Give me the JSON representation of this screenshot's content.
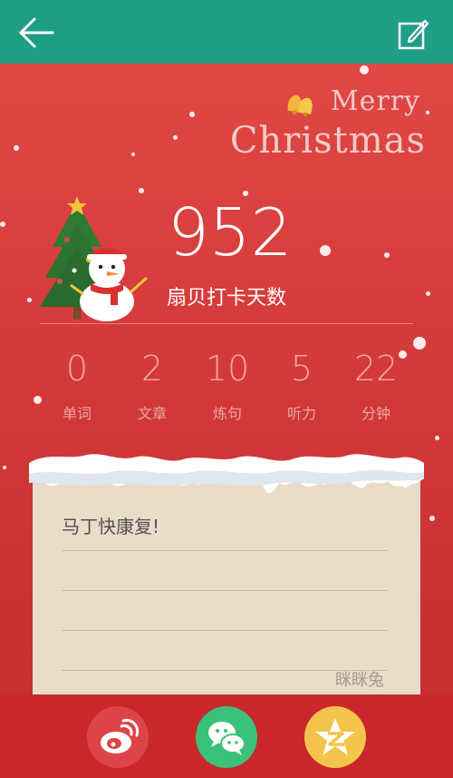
{
  "topbar": {
    "back_icon": "arrow-left-icon",
    "edit_icon": "edit-note-icon"
  },
  "banner": {
    "merry": "Merry",
    "christmas": "Christmas"
  },
  "checkin": {
    "days": "952",
    "label": "扇贝打卡天数"
  },
  "stats": [
    {
      "value": "0",
      "label": "单词"
    },
    {
      "value": "2",
      "label": "文章"
    },
    {
      "value": "10",
      "label": "炼句"
    },
    {
      "value": "5",
      "label": "听力"
    },
    {
      "value": "22",
      "label": "分钟"
    }
  ],
  "note": {
    "text": "马丁快康复!",
    "author": "眯眯兔"
  },
  "share": [
    {
      "name": "weibo",
      "icon": "weibo-icon",
      "color": "#dd4448"
    },
    {
      "name": "wechat",
      "icon": "wechat-icon",
      "color": "#3cc17a"
    },
    {
      "name": "qzone",
      "icon": "qzone-icon",
      "color": "#f3c44a"
    }
  ],
  "colors": {
    "topbar": "#1f9e86",
    "background": "#d83b3b",
    "note": "#e9ddc9"
  }
}
